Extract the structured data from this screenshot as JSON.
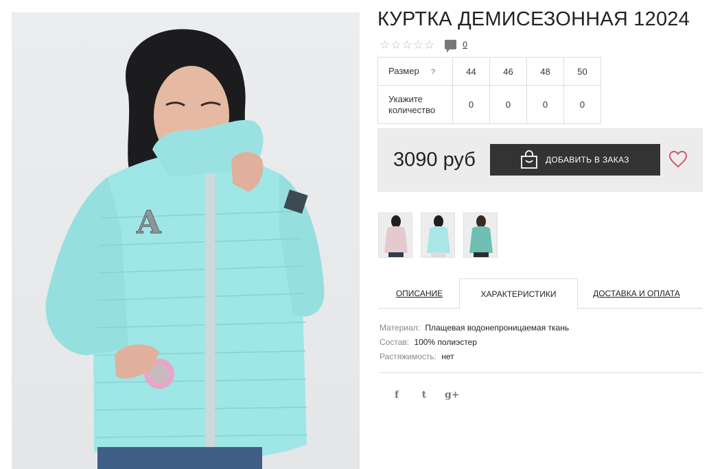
{
  "product": {
    "title": "КУРТКА ДЕМИСЕЗОННАЯ 12024",
    "rating_stars": 5,
    "reviews_count": "0",
    "price": "3090 руб",
    "add_to_cart_label": "ДОБАВИТЬ В ЗАКАЗ"
  },
  "size_table": {
    "size_label": "Размер",
    "help_mark": "?",
    "sizes": [
      "44",
      "46",
      "48",
      "50"
    ],
    "qty_label_line1": "Укажите",
    "qty_label_line2": "количество",
    "quantities": [
      "0",
      "0",
      "0",
      "0"
    ]
  },
  "thumbnails": [
    {
      "name": "thumbnail-pink-jacket",
      "color": "#e6c9cf"
    },
    {
      "name": "thumbnail-mint-jacket",
      "color": "#a9e7e6"
    },
    {
      "name": "thumbnail-teal-jacket",
      "color": "#6fbfb3"
    }
  ],
  "tabs": {
    "description": "ОПИСАНИЕ",
    "characteristics": "ХАРАКТЕРИСТИКИ",
    "delivery": "ДОСТАВКА И ОПЛАТА",
    "active": "characteristics"
  },
  "specs": [
    {
      "key": "Материал:",
      "value": "Плащевая водонепроницаемая ткань"
    },
    {
      "key": "Состав:",
      "value": "100% полиэстер"
    },
    {
      "key": "Растяжимость:",
      "value": "нет"
    }
  ],
  "social": [
    {
      "name": "facebook-icon",
      "glyph": "f"
    },
    {
      "name": "twitter-icon",
      "glyph": "t"
    },
    {
      "name": "google-plus-icon",
      "glyph": "g+"
    }
  ],
  "colors": {
    "jacket": "#9fe6e6",
    "button": "#333333",
    "buybox": "#ececec",
    "heart": "#d9546b"
  }
}
